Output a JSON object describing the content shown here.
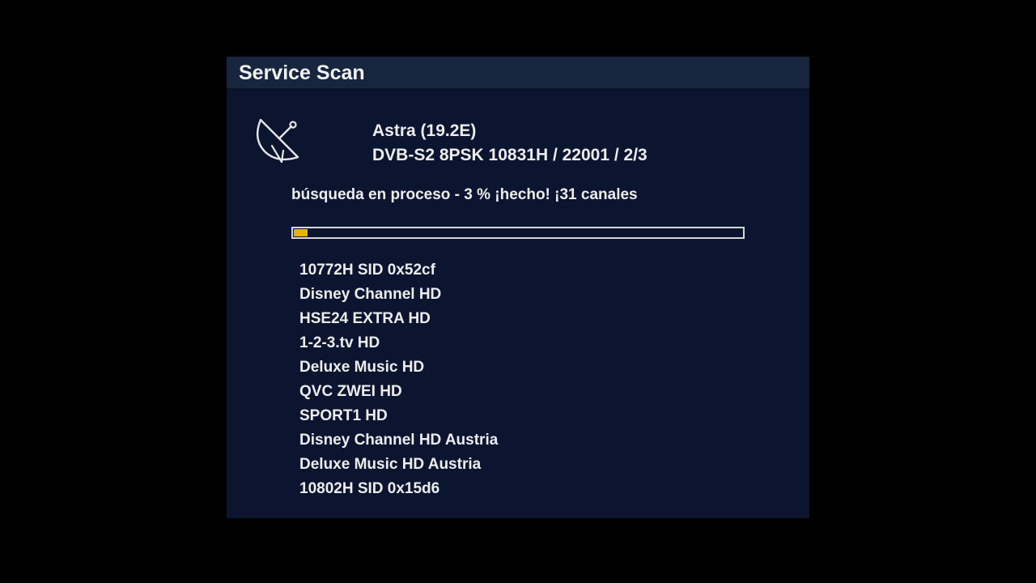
{
  "window": {
    "title": "Service Scan"
  },
  "transponder": {
    "satellite": "Astra (19.2E)",
    "tuning": "DVB-S2 8PSK 10831H / 22001 / 2/3",
    "icon": "satellite-dish-icon"
  },
  "scan": {
    "status": "búsqueda en proceso - 3 % ¡hecho! ¡31 canales",
    "progress_percent": 3
  },
  "channels": [
    "10772H SID 0x52cf",
    "Disney Channel HD",
    "HSE24 EXTRA HD",
    "1-2-3.tv HD",
    "Deluxe Music HD",
    "QVC ZWEI HD",
    "SPORT1 HD",
    "Disney Channel HD Austria",
    "Deluxe Music HD Austria",
    "10802H SID 0x15d6"
  ],
  "colors": {
    "background": "#000000",
    "panel": "#0c1530",
    "titlebar": "#17253f",
    "progress_fill": "#e2b400",
    "text": "#ededed"
  }
}
